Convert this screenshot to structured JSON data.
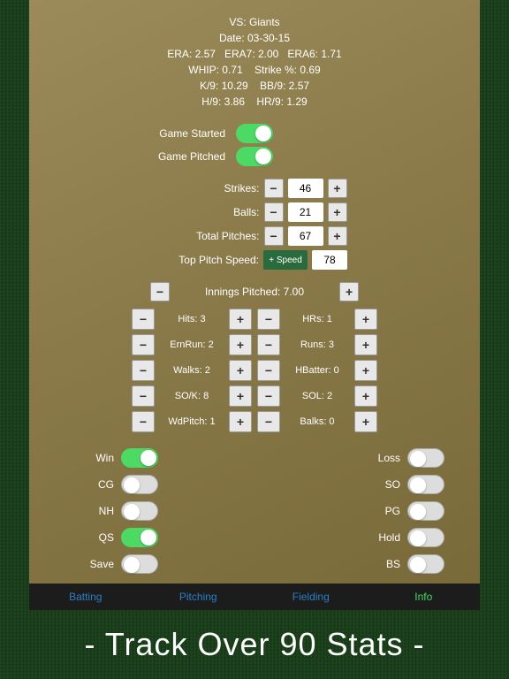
{
  "header": {
    "vs": "VS: Giants",
    "date": "Date: 03-30-15",
    "era_line": "ERA: 2.57   ERA7: 2.00   ERA6: 1.71",
    "whip_line": "WHIP: 0.71    Strike %: 0.69",
    "k9_line": "K/9: 10.29    BB/9: 2.57",
    "h9_line": "H/9: 3.86    HR/9: 1.29"
  },
  "game_toggles": {
    "started_label": "Game Started",
    "started_on": true,
    "pitched_label": "Game Pitched",
    "pitched_on": true
  },
  "counters": {
    "strikes": {
      "label": "Strikes:",
      "value": "46"
    },
    "balls": {
      "label": "Balls:",
      "value": "21"
    },
    "total": {
      "label": "Total Pitches:",
      "value": "67"
    },
    "top_speed": {
      "label": "Top Pitch Speed:",
      "button": "+ Speed",
      "value": "78"
    }
  },
  "innings": {
    "label": "Innings Pitched: 7.00"
  },
  "stats_left": [
    {
      "label": "Hits: 3"
    },
    {
      "label": "ErnRun: 2"
    },
    {
      "label": "Walks: 2"
    },
    {
      "label": "SO/K: 8"
    },
    {
      "label": "WdPitch: 1"
    }
  ],
  "stats_right": [
    {
      "label": "HRs: 1"
    },
    {
      "label": "Runs: 3"
    },
    {
      "label": "HBatter: 0"
    },
    {
      "label": "SOL: 2"
    },
    {
      "label": "Balks: 0"
    }
  ],
  "result_toggles_left": [
    {
      "label": "Win",
      "on": true
    },
    {
      "label": "CG",
      "on": false
    },
    {
      "label": "NH",
      "on": false
    },
    {
      "label": "QS",
      "on": true
    },
    {
      "label": "Save",
      "on": false
    }
  ],
  "result_toggles_right": [
    {
      "label": "Loss",
      "on": false
    },
    {
      "label": "SO",
      "on": false
    },
    {
      "label": "PG",
      "on": false
    },
    {
      "label": "Hold",
      "on": false
    },
    {
      "label": "BS",
      "on": false
    }
  ],
  "tabs": {
    "batting": "Batting",
    "pitching": "Pitching",
    "fielding": "Fielding",
    "info": "Info"
  },
  "caption": "- Track Over 90 Stats -",
  "glyphs": {
    "minus": "−",
    "plus": "+"
  }
}
